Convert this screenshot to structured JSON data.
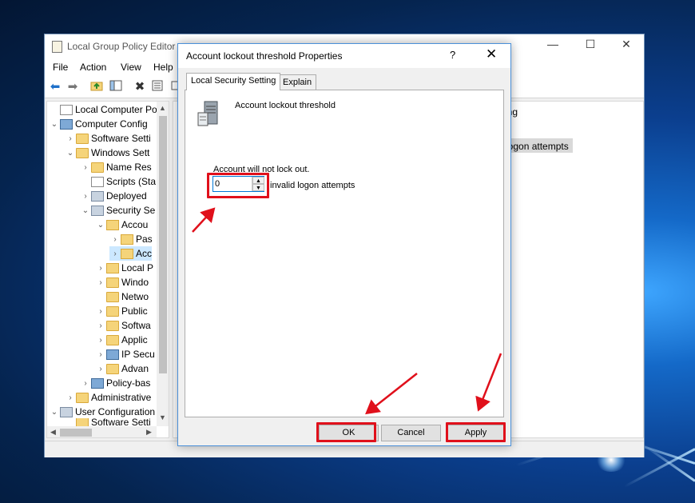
{
  "main_window": {
    "title": "Local Group Policy Editor",
    "menu": [
      "File",
      "Action",
      "View",
      "Help"
    ],
    "toolbar_icons": [
      "back-icon",
      "forward-icon",
      "up-folder-icon",
      "show-hide-tree-icon",
      "delete-icon",
      "properties-icon",
      "export-icon"
    ],
    "window_controls": {
      "minimize": "—",
      "maximize": "☐",
      "close": "✕"
    }
  },
  "tree": {
    "items": [
      {
        "label": "Local Computer Polic",
        "icon": "doc-icon"
      },
      {
        "label": "Computer Config",
        "icon": "computer-icon"
      },
      {
        "label": "Software Setti",
        "icon": "folder-icon"
      },
      {
        "label": "Windows Sett",
        "icon": "folder-icon"
      },
      {
        "label": "Name Res",
        "icon": "folder-icon"
      },
      {
        "label": "Scripts (Sta",
        "icon": "script-icon"
      },
      {
        "label": "Deployed",
        "icon": "printer-icon"
      },
      {
        "label": "Security Se",
        "icon": "security-icon"
      },
      {
        "label": "Accou",
        "icon": "locked-folder-icon"
      },
      {
        "label": "Pas",
        "icon": "locked-folder-icon"
      },
      {
        "label": "Acc",
        "icon": "locked-folder-icon"
      },
      {
        "label": "Local P",
        "icon": "locked-folder-icon"
      },
      {
        "label": "Windo",
        "icon": "folder-icon"
      },
      {
        "label": "Netwo",
        "icon": "folder-icon"
      },
      {
        "label": "Public",
        "icon": "folder-icon"
      },
      {
        "label": "Softwa",
        "icon": "folder-icon"
      },
      {
        "label": "Applic",
        "icon": "folder-icon"
      },
      {
        "label": "IP Secu",
        "icon": "ip-security-icon"
      },
      {
        "label": "Advan",
        "icon": "folder-icon"
      },
      {
        "label": "Policy-bas",
        "icon": "chart-icon"
      },
      {
        "label": "Administrative",
        "icon": "folder-icon"
      },
      {
        "label": "User Configuration",
        "icon": "user-icon"
      },
      {
        "label": "Software Setti",
        "icon": "folder-icon"
      }
    ]
  },
  "right_pane": {
    "column_header": "ing",
    "item": "logon attempts"
  },
  "dialog": {
    "title": "Account lockout threshold Properties",
    "help": "?",
    "close": "✕",
    "tabs": [
      "Local Security Setting",
      "Explain"
    ],
    "policy_name": "Account lockout threshold",
    "status_message": "Account will not lock out.",
    "threshold_value": "0",
    "unit_label": "invalid logon attempts",
    "buttons": {
      "ok": "OK",
      "cancel": "Cancel",
      "apply": "Apply"
    }
  },
  "colors": {
    "highlight_red": "#e0101b",
    "focus_blue": "#0078d7",
    "desktop_blue": "#0b3f8f"
  }
}
